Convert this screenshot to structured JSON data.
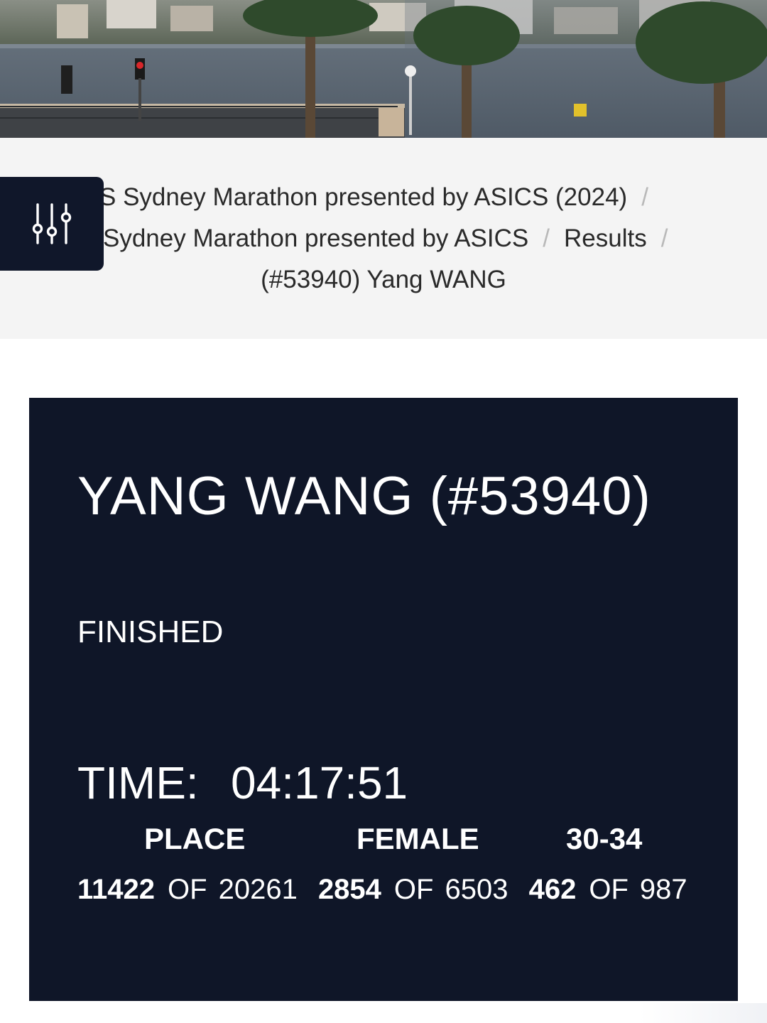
{
  "breadcrumb": {
    "items": [
      "S Sydney Marathon presented by ASICS (2024)",
      "Sydney Marathon presented by ASICS",
      "Results",
      "(#53940) Yang WANG"
    ],
    "separator": "/"
  },
  "filter_button": {
    "icon": "sliders-icon"
  },
  "result": {
    "runner_heading": "YANG WANG (#53940)",
    "status": "FINISHED",
    "time_label": "TIME:",
    "time_value": "04:17:51",
    "rankings": [
      {
        "label": "PLACE",
        "rank": "11422",
        "of_label": "OF",
        "total": "20261"
      },
      {
        "label": "FEMALE",
        "rank": "2854",
        "of_label": "OF",
        "total": "6503"
      },
      {
        "label": "30-34",
        "rank": "462",
        "of_label": "OF",
        "total": "987"
      }
    ]
  },
  "colors": {
    "card_background": "#0f1628",
    "breadcrumb_band": "#f4f4f4",
    "separator": "#b9b9b9"
  }
}
